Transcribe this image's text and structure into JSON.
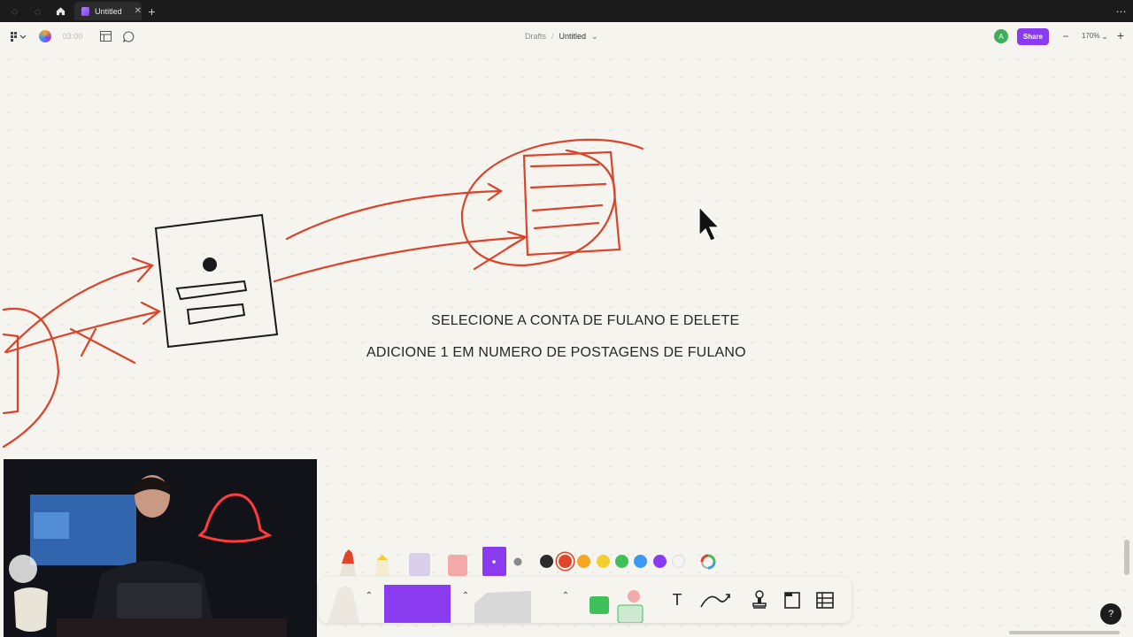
{
  "tab": {
    "title": "Untitled"
  },
  "breadcrumb": {
    "parent": "Drafts",
    "separator": "/",
    "current": "Untitled"
  },
  "toolbar": {
    "timer": "03:00",
    "share_label": "Share",
    "zoom": "170%",
    "avatar_initial": "A"
  },
  "canvas": {
    "notes": [
      "SELECIONE A CONTA DE FULANO E DELETE",
      "ADICIONE 1 EM NUMERO DE POSTAGENS DE FULANO"
    ]
  },
  "palette": {
    "colors": [
      "#2b2b2b",
      "#e0452a",
      "#f5a623",
      "#f2cf2e",
      "#3fc05a",
      "#3b9af0",
      "#8a3bf0",
      "#f4f4f4"
    ]
  },
  "dock": {
    "text_tool": "T"
  },
  "help": {
    "label": "?"
  },
  "accent": "#8a3bf0",
  "sketch_color": "#d9442b"
}
